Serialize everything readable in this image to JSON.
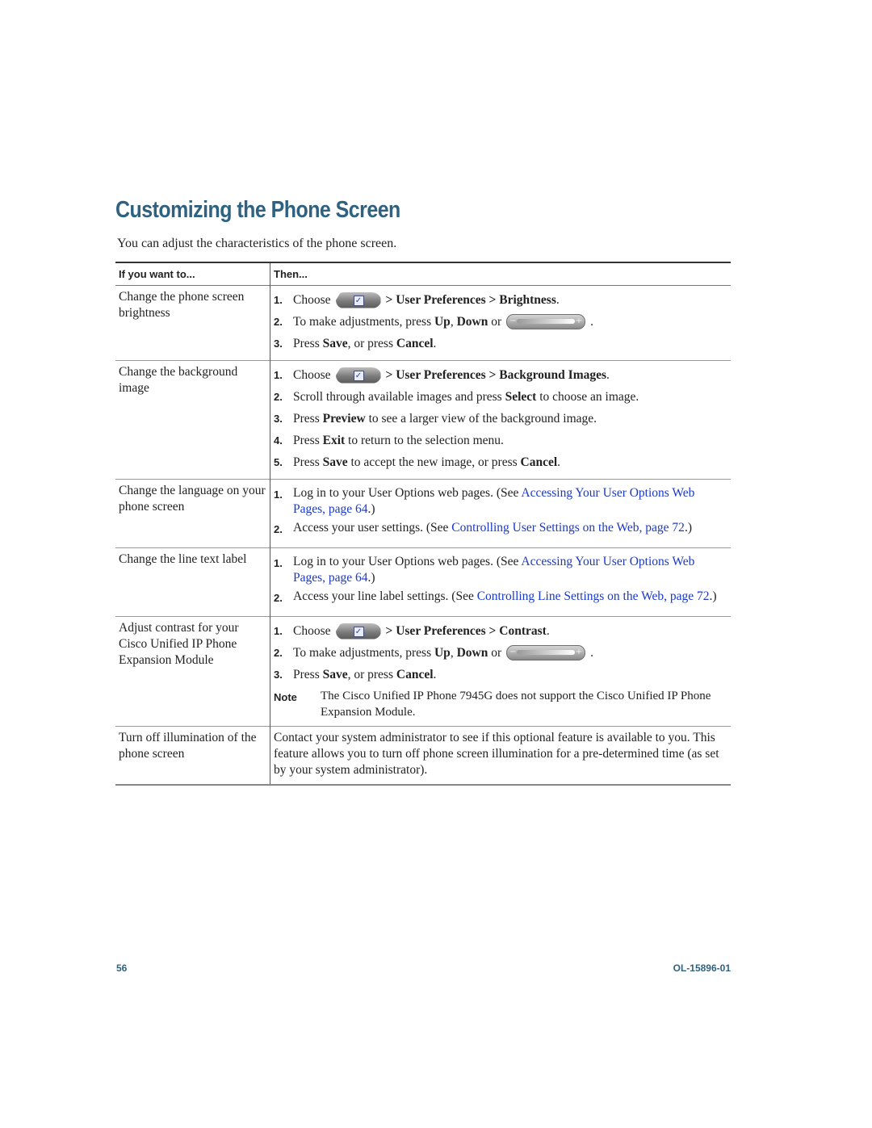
{
  "title": "Customizing the Phone Screen",
  "intro": "You can adjust the characteristics of the phone screen.",
  "table": {
    "headers": [
      "If you want to...",
      "Then..."
    ],
    "rows": [
      {
        "task": "Change the phone screen brightness",
        "steps": [
          {
            "num": "1.",
            "pre": "Choose",
            "icon": "settings-button-icon",
            "menu": "> User Preferences > Brightness",
            "post": "."
          },
          {
            "num": "2.",
            "pre": "To make adjustments, press ",
            "b1": "Up",
            "mid": ", ",
            "b2": "Down",
            "post": " or",
            "icon": "navigation-bar-icon",
            "end": "."
          },
          {
            "num": "3.",
            "pre": "Press ",
            "b1": "Save",
            "mid": ", or press ",
            "b2": "Cancel",
            "post": "."
          }
        ]
      },
      {
        "task": "Change the background image",
        "steps": [
          {
            "num": "1.",
            "pre": "Choose",
            "icon": "settings-button-icon",
            "menu": "> User Preferences > Background Images",
            "post": "."
          },
          {
            "num": "2.",
            "pre": "Scroll through available images and press ",
            "b1": "Select",
            "post": " to choose an image."
          },
          {
            "num": "3.",
            "pre": "Press ",
            "b1": "Preview",
            "post": " to see a larger view of the background image."
          },
          {
            "num": "4.",
            "pre": "Press ",
            "b1": "Exit",
            "post": " to return to the selection menu."
          },
          {
            "num": "5.",
            "pre": "Press ",
            "b1": "Save",
            "mid": " to accept the new image, or press ",
            "b2": "Cancel",
            "post": "."
          }
        ]
      },
      {
        "task": "Change the language on your phone screen",
        "steps": [
          {
            "num": "1.",
            "pre": "Log in to your User Options web pages. (See ",
            "link": "Accessing Your User Options Web Pages, page 64",
            "post": ".)"
          },
          {
            "num": "2.",
            "pre": "Access your user settings. (See ",
            "link": "Controlling User Settings on the Web, page 72",
            "post": ".)"
          }
        ]
      },
      {
        "task": "Change the line text label",
        "steps": [
          {
            "num": "1.",
            "pre": "Log in to your User Options web pages. (See ",
            "link": "Accessing Your User Options Web Pages, page 64",
            "post": ".)"
          },
          {
            "num": "2.",
            "pre": "Access your line label settings. (See ",
            "link": "Controlling Line Settings on the Web, page 72",
            "post": ".)"
          }
        ]
      },
      {
        "task": "Adjust contrast for your Cisco Unified IP Phone Expansion Module",
        "steps": [
          {
            "num": "1.",
            "pre": "Choose",
            "icon": "settings-button-icon",
            "menu": "> User Preferences > Contrast",
            "post": "."
          },
          {
            "num": "2.",
            "pre": "To make adjustments, press ",
            "b1": "Up",
            "mid": ", ",
            "b2": "Down",
            "post": " or",
            "icon": "navigation-bar-icon",
            "end": "."
          },
          {
            "num": "3.",
            "pre": "Press ",
            "b1": "Save",
            "mid": ", or press ",
            "b2": "Cancel",
            "post": "."
          }
        ],
        "note": {
          "label": "Note",
          "text": "The Cisco Unified IP Phone 7945G does not support the Cisco Unified IP Phone Expansion Module."
        }
      },
      {
        "task": "Turn off illumination of the phone screen",
        "text": "Contact your system administrator to see if this optional feature is available to you. This feature allows you to turn off phone screen illumination for a pre-determined time (as set by your system administrator)."
      }
    ]
  },
  "footer": {
    "page": "56",
    "doc_id": "OL-15896-01"
  },
  "colors": {
    "heading": "#2f6281",
    "link": "#1a39c7"
  }
}
